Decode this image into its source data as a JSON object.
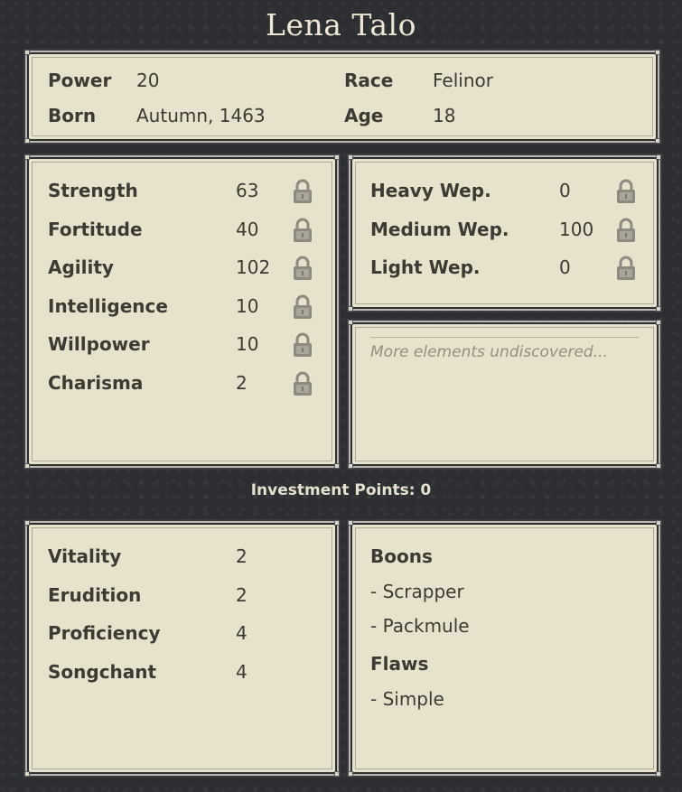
{
  "character": {
    "name": "Lena Talo"
  },
  "info": {
    "power_label": "Power",
    "power_value": "20",
    "born_label": "Born",
    "born_value": "Autumn, 1463",
    "race_label": "Race",
    "race_value": "Felinor",
    "age_label": "Age",
    "age_value": "18"
  },
  "attributes": [
    {
      "label": "Strength",
      "value": "63"
    },
    {
      "label": "Fortitude",
      "value": "40"
    },
    {
      "label": "Agility",
      "value": "102"
    },
    {
      "label": "Intelligence",
      "value": "10"
    },
    {
      "label": "Willpower",
      "value": "10"
    },
    {
      "label": "Charisma",
      "value": "2"
    }
  ],
  "weapons": [
    {
      "label": "Heavy Wep.",
      "value": "0"
    },
    {
      "label": "Medium Wep.",
      "value": "100"
    },
    {
      "label": "Light Wep.",
      "value": "0"
    }
  ],
  "elements": {
    "placeholder": "More elements undiscovered..."
  },
  "investment": {
    "text": "Investment Points: 0"
  },
  "investments": [
    {
      "label": "Vitality",
      "value": "2"
    },
    {
      "label": "Erudition",
      "value": "2"
    },
    {
      "label": "Proficiency",
      "value": "4"
    },
    {
      "label": "Songchant",
      "value": "4"
    }
  ],
  "traits": {
    "boons_heading": "Boons",
    "boons": [
      "- Scrapper",
      "- Packmule"
    ],
    "flaws_heading": "Flaws",
    "flaws": [
      "- Simple"
    ]
  },
  "icons": {
    "lock": "lock-icon"
  },
  "colors": {
    "panel": "#e7e2cb",
    "background": "#2d2e32",
    "text": "#3d3a33",
    "title": "#ece6d2"
  }
}
